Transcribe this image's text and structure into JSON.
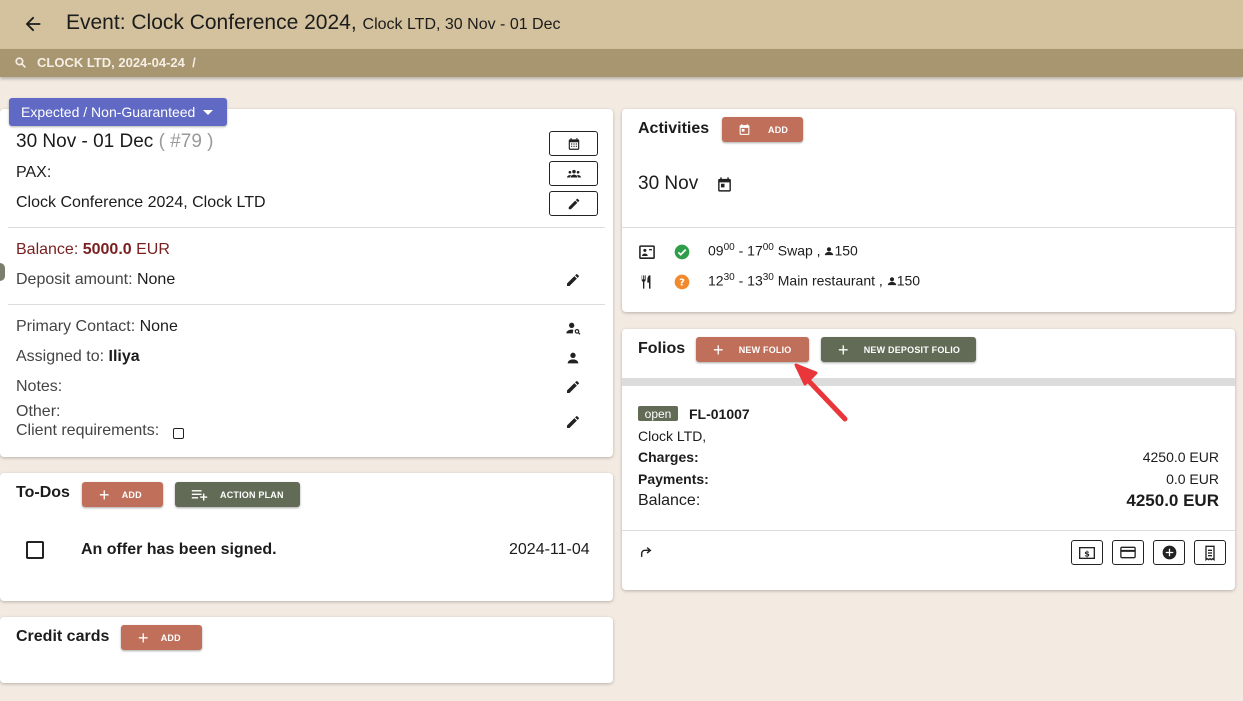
{
  "header": {
    "title": "Event: Clock Conference 2024,",
    "subtitle": "Clock LTD, 30 Nov - 01 Dec",
    "breadcrumb": "CLOCK LTD, 2024-04-24",
    "breadcrumb_sep": "/"
  },
  "status": {
    "label": "Expected / Non-Guaranteed"
  },
  "event_card": {
    "dates": "30 Nov - 01 Dec",
    "number": "( #79 )",
    "pax_label": "PAX:",
    "name": "Clock Conference 2024, Clock LTD",
    "balance_label": "Balance:",
    "balance_value": "5000.0",
    "balance_currency": "EUR",
    "deposit_label": "Deposit amount:",
    "deposit_value": "None",
    "primary_contact_label": "Primary Contact:",
    "primary_contact_value": "None",
    "assigned_label": "Assigned to:",
    "assigned_value": "Iliya",
    "notes_label": "Notes:",
    "other_label": "Other:",
    "client_req_label": "Client requirements:"
  },
  "todos": {
    "title": "To-Dos",
    "add_label": "ADD",
    "action_plan_label": "ACTION PLAN",
    "items": [
      {
        "text": "An offer has been signed.",
        "date": "2024-11-04"
      }
    ]
  },
  "credit_cards": {
    "title": "Credit cards",
    "add_label": "ADD"
  },
  "activities": {
    "title": "Activities",
    "add_label": "ADD",
    "date": "30 Nov",
    "items": [
      {
        "start_h": "09",
        "start_m": "00",
        "end_h": "17",
        "end_m": "00",
        "location": "Swap ,",
        "pax": "150",
        "status_icon": "check-circle-icon",
        "type_icon": "presentation-icon"
      },
      {
        "start_h": "12",
        "start_m": "30",
        "end_h": "13",
        "end_m": "30",
        "location": "Main restaurant ,",
        "pax": "150",
        "status_icon": "question-circle-icon",
        "type_icon": "restaurant-icon"
      }
    ]
  },
  "folios": {
    "title": "Folios",
    "new_folio_label": "NEW FOLIO",
    "new_deposit_label": "NEW DEPOSIT FOLIO",
    "folio": {
      "status": "open",
      "id": "FL-01007",
      "company": "Clock LTD,",
      "charges_label": "Charges:",
      "charges_value": "4250.0 EUR",
      "payments_label": "Payments:",
      "payments_value": "0.0 EUR",
      "balance_label": "Balance:",
      "balance_value": "4250.0 EUR"
    }
  },
  "colors": {
    "header_bg": "#d3c29d",
    "breadcrumb_bg": "#a89670",
    "status_bg": "#6069c3",
    "orange_button": "#c0705a",
    "green_button": "#616b56",
    "balance_red": "#7a1f1f",
    "check_green": "#2e9e4a",
    "question_orange": "#f08a2c",
    "arrow_red": "#e8363a"
  }
}
